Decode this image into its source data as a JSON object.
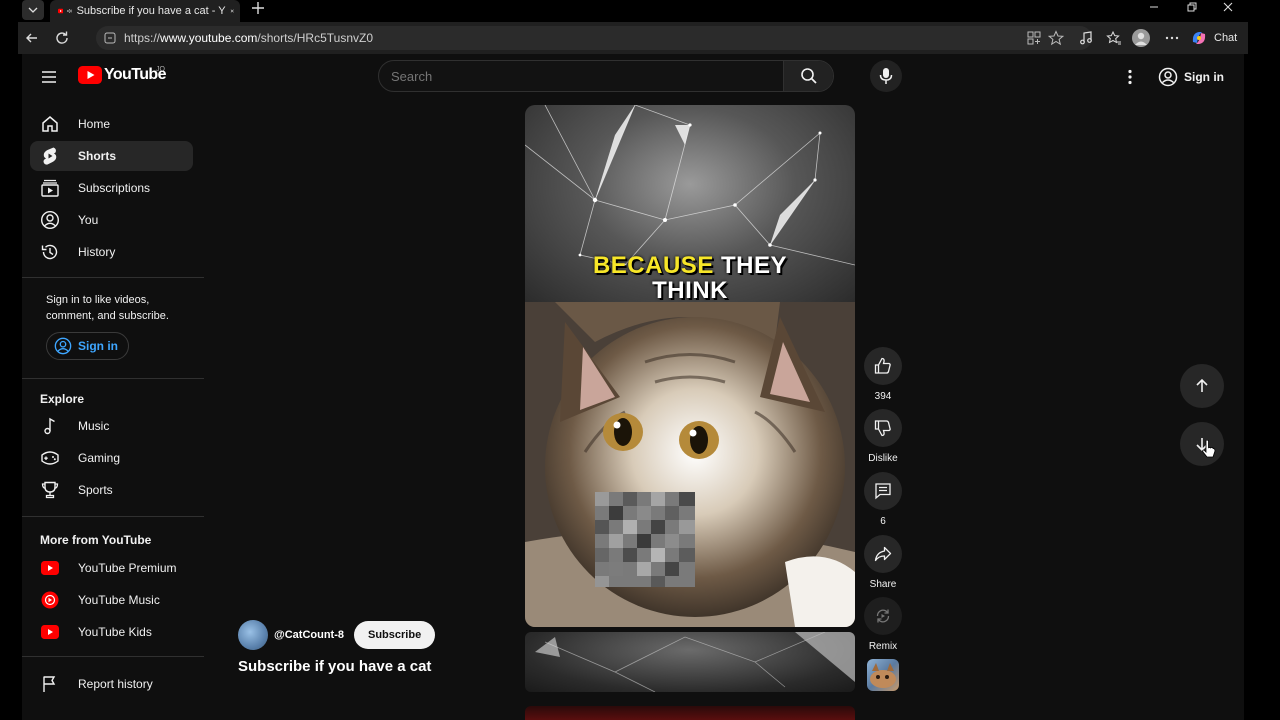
{
  "browser": {
    "tab_title": "Subscribe if you have a cat - Y",
    "url_scheme": "https://",
    "url_host": "www.youtube.com",
    "url_path": "/shorts/HRc5TusnvZ0",
    "chat_label": "Chat"
  },
  "masthead": {
    "logo_text": "YouTube",
    "country_code": "JO",
    "search_placeholder": "Search",
    "signin_label": "Sign in"
  },
  "sidebar": {
    "main": [
      {
        "label": "Home",
        "icon": "home-icon"
      },
      {
        "label": "Shorts",
        "icon": "shorts-icon",
        "active": true
      },
      {
        "label": "Subscriptions",
        "icon": "subscriptions-icon"
      },
      {
        "label": "You",
        "icon": "you-icon"
      },
      {
        "label": "History",
        "icon": "history-icon"
      }
    ],
    "signin_prompt": "Sign in to like videos, comment, and subscribe.",
    "signin_button": "Sign in",
    "explore_title": "Explore",
    "explore": [
      {
        "label": "Music",
        "icon": "music-icon"
      },
      {
        "label": "Gaming",
        "icon": "gaming-icon"
      },
      {
        "label": "Sports",
        "icon": "sports-icon"
      }
    ],
    "more_title": "More from YouTube",
    "more": [
      {
        "label": "YouTube Premium",
        "icon": "youtube-premium-icon"
      },
      {
        "label": "YouTube Music",
        "icon": "youtube-music-icon"
      },
      {
        "label": "YouTube Kids",
        "icon": "youtube-kids-icon"
      }
    ],
    "report_history": "Report history"
  },
  "short": {
    "caption_highlight": "BECAUSE",
    "caption_rest_line1": " THEY",
    "caption_line2": "THINK",
    "channel": "@CatCount-8",
    "subscribe_label": "Subscribe",
    "title": "Subscribe if you have a cat"
  },
  "actions": {
    "like_count": "394",
    "dislike_label": "Dislike",
    "comment_count": "6",
    "share_label": "Share",
    "remix_label": "Remix"
  },
  "colors": {
    "youtube_red": "#ff0000",
    "link_blue": "#3ea6ff",
    "caption_yellow": "#f7e628"
  }
}
